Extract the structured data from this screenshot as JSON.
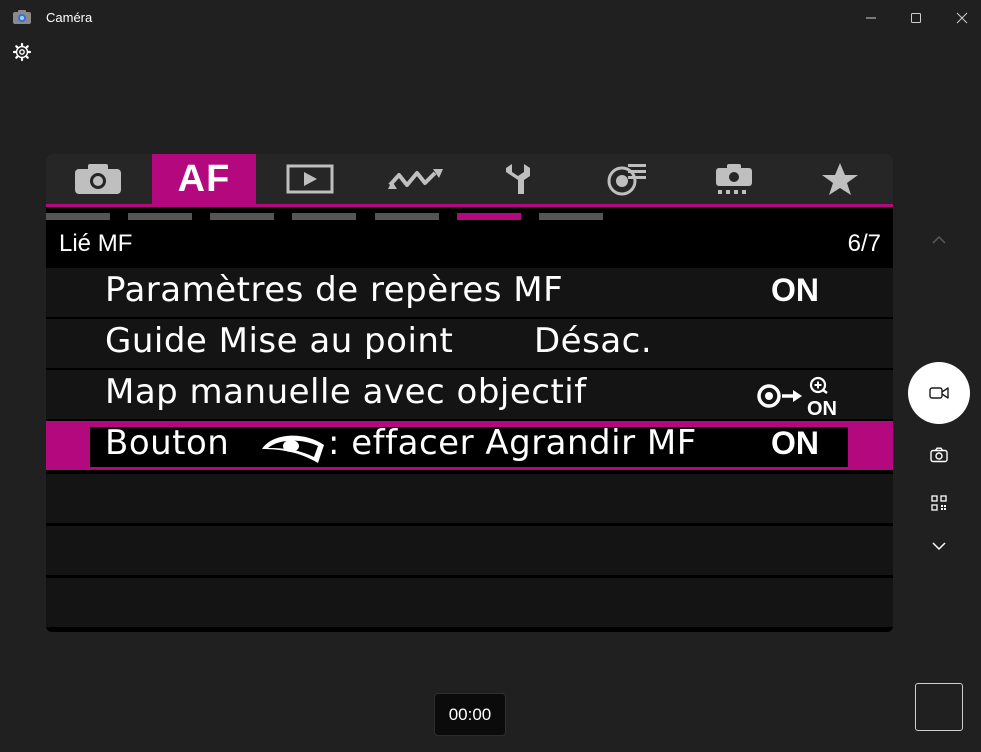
{
  "window": {
    "title": "Caméra",
    "icons": [
      "camera-app-icon",
      "settings-gear-icon",
      "minimize-icon",
      "maximize-icon",
      "close-icon"
    ]
  },
  "camera_menu": {
    "tabs": [
      {
        "icon": "camera-shooting-icon"
      },
      {
        "label": "AF",
        "active": true
      },
      {
        "icon": "playback-icon"
      },
      {
        "icon": "wireless-icon"
      },
      {
        "icon": "wrench-setup-icon"
      },
      {
        "icon": "custom-functions-icon"
      },
      {
        "icon": "shooting-info-icon"
      },
      {
        "icon": "star-my-menu-icon"
      }
    ],
    "page_indicators": 7,
    "active_page_index": 5,
    "section_title": "Lié MF",
    "page_number": "6/7",
    "rows": [
      {
        "label": "Paramètres de repères MF",
        "value": "ON"
      },
      {
        "label": "Guide Mise au point",
        "value": "Désac."
      },
      {
        "label": "Map manuelle avec objectif",
        "value_icon": "eye-arrow-zoom-on-icon",
        "value_icon_text": "ON"
      },
      {
        "label_prefix": "Bouton",
        "label_icon": "eye-detection-icon",
        "label_suffix": ": effacer Agrandir MF",
        "value": "ON",
        "selected": true
      }
    ],
    "empty_rows": 3,
    "accent_color": "#b3087e"
  },
  "controls": {
    "timer": "00:00",
    "icons": [
      "chevron-up-icon",
      "video-mode-icon",
      "photo-mode-icon",
      "qr-scan-icon",
      "chevron-down-icon"
    ]
  }
}
